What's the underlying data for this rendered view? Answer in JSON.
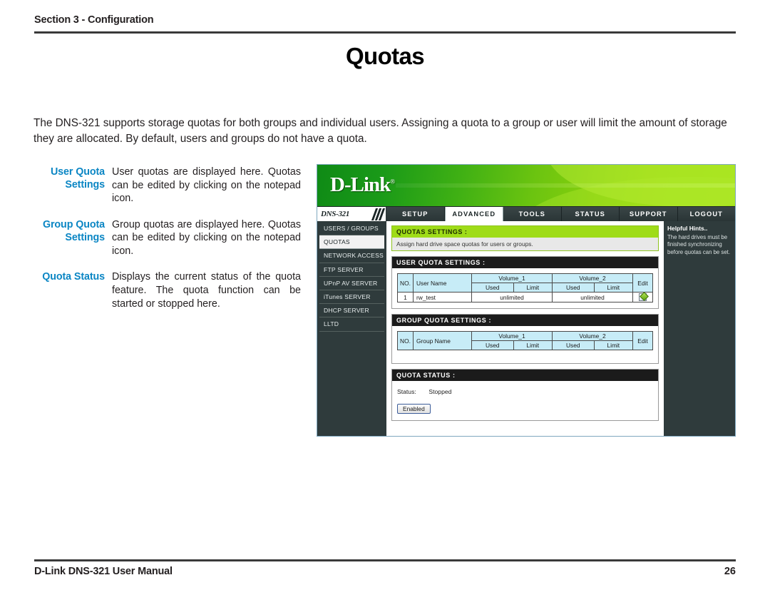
{
  "manual": {
    "section_header": "Section 3 - Configuration",
    "title": "Quotas",
    "intro": "The DNS-321 supports storage quotas for both groups and individual users.  Assigning a quota to a group or user will limit the amount of storage they are allocated. By default, users and groups do not have a quota.",
    "footer_left": "D-Link DNS-321 User Manual",
    "footer_page": "26"
  },
  "descriptions": [
    {
      "term": "User Quota Settings",
      "text": "User quotas are displayed here. Quotas can be edited by clicking on the notepad icon."
    },
    {
      "term": "Group Quota Settings",
      "text": "Group quotas are displayed here. Quotas can be edited by clicking on the notepad icon."
    },
    {
      "term": "Quota Status",
      "text": "Displays the current status of the quota feature. The quota function can be started or stopped here."
    }
  ],
  "ui": {
    "brand": "D-Link",
    "brand_tm": "®",
    "model": "DNS-321",
    "nav_tabs": [
      {
        "label": "SETUP",
        "active": false
      },
      {
        "label": "ADVANCED",
        "active": true
      },
      {
        "label": "TOOLS",
        "active": false
      },
      {
        "label": "STATUS",
        "active": false
      },
      {
        "label": "SUPPORT",
        "active": false
      },
      {
        "label": "LOGOUT",
        "active": false
      }
    ],
    "sidebar": [
      {
        "label": "USERS / GROUPS",
        "selected": false
      },
      {
        "label": "QUOTAS",
        "selected": true
      },
      {
        "label": "NETWORK ACCESS",
        "selected": false
      },
      {
        "label": "FTP SERVER",
        "selected": false
      },
      {
        "label": "UPnP AV SERVER",
        "selected": false
      },
      {
        "label": "iTunes SERVER",
        "selected": false
      },
      {
        "label": "DHCP SERVER",
        "selected": false
      },
      {
        "label": "LLTD",
        "selected": false
      }
    ],
    "quotas_settings": {
      "header": "QUOTAS SETTINGS :",
      "description": "Assign hard drive space quotas for users or groups."
    },
    "user_quota": {
      "header": "USER QUOTA SETTINGS :",
      "col_no": "NO.",
      "col_name": "User Name",
      "col_vol1": "Volume_1",
      "col_vol2": "Volume_2",
      "col_used": "Used",
      "col_limit": "Limit",
      "col_edit": "Edit",
      "rows": [
        {
          "no": "1",
          "name": "rw_test",
          "vol1": "unlimited",
          "vol2": "unlimited"
        }
      ]
    },
    "group_quota": {
      "header": "GROUP QUOTA SETTINGS :",
      "col_no": "NO.",
      "col_name": "Group Name",
      "col_vol1": "Volume_1",
      "col_vol2": "Volume_2",
      "col_used": "Used",
      "col_limit": "Limit",
      "col_edit": "Edit",
      "rows": []
    },
    "quota_status": {
      "header": "QUOTA STATUS :",
      "status_label": "Status:",
      "status_value": "Stopped",
      "button": "Enabled"
    },
    "hints": {
      "title": "Helpful Hints..",
      "text": "The hard drives must be finished synchronizing before quotas can be set."
    },
    "colors": {
      "accent_blue": "#0b86c4",
      "brand_green": "#9fdc18",
      "banner_green_dark": "#0f8a16",
      "banner_green_light": "#9ade0b",
      "nav_dark": "#2f3b3c",
      "table_header_blue": "#c7ecf7"
    }
  }
}
